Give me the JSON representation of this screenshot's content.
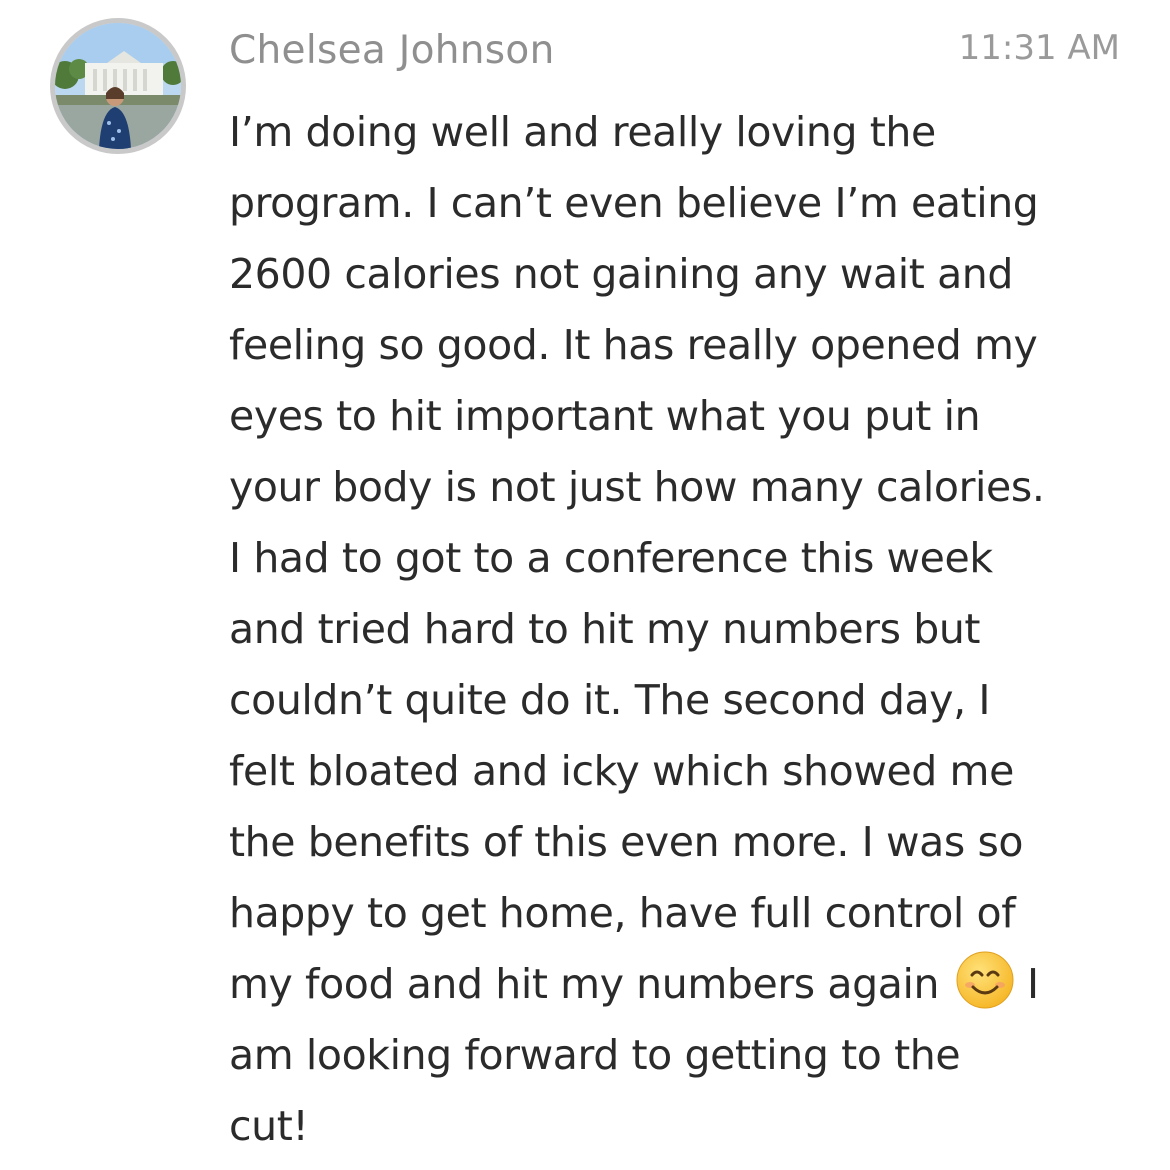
{
  "message": {
    "sender": "Chelsea Johnson",
    "timestamp": "11:31 AM",
    "lines": [
      "I’m doing well and really loving the",
      "program. I can’t even believe I’m eating",
      "2600 calories not gaining any wait and",
      "feeling so good. It has really opened my",
      "eyes to hit important what you put in",
      "your body is not just how many calories.",
      "I had to got to a conference this week",
      "and tried hard to hit my numbers but",
      "couldn’t quite do it. The second day, I",
      "felt bloated and icky which showed me",
      "the benefits of this even more. I was so",
      "happy to get home, have full control of"
    ],
    "emoji_line": {
      "before": "my food and hit my numbers again",
      "emoji": "smiling-face-icon",
      "after": "I"
    },
    "tail_lines": [
      "am looking forward to getting to the",
      "cut!"
    ]
  },
  "colors": {
    "text": "#2b2b2b",
    "sender": "#8f8f8f",
    "timestamp": "#9a9a9a",
    "avatar_border": "#c9c9c9",
    "emoji_face": "#ffc83d"
  }
}
